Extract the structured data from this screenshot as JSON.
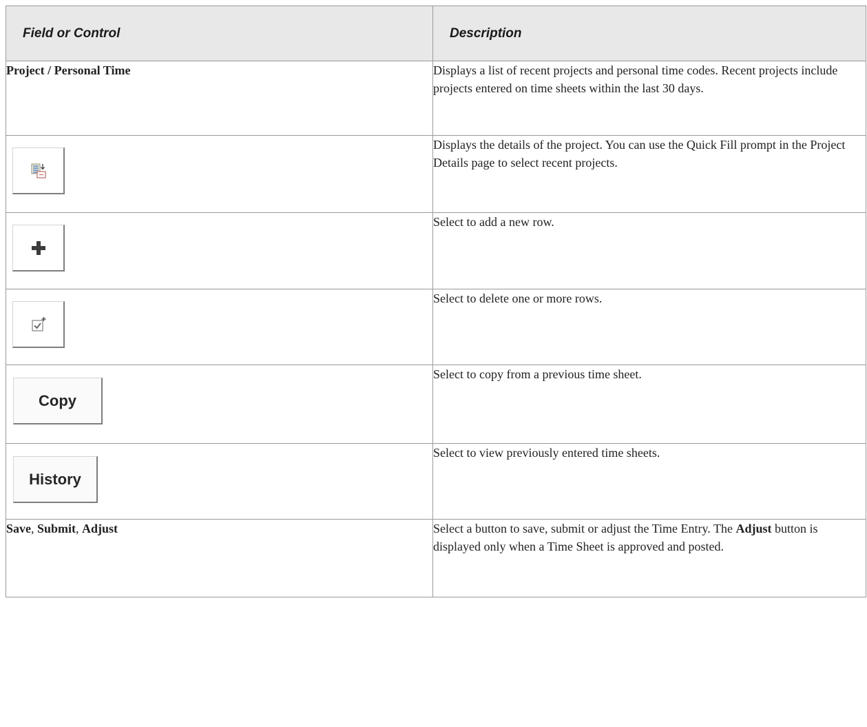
{
  "table": {
    "header": {
      "field": "Field or Control",
      "description": "Description"
    },
    "rows": [
      {
        "field": "Project / Personal Time",
        "description": "Displays a list of recent projects and personal time codes.  Recent projects include projects entered on time sheets within the last 30 days."
      },
      {
        "icon": "project-details-icon",
        "description": "Displays the details of the project. You can use the Quick Fill prompt in the Project Details page to select recent projects."
      },
      {
        "icon": "plus-icon",
        "description": "Select to add a new row."
      },
      {
        "icon": "delete-rows-checkbox-icon",
        "description": "Select to delete one or more rows."
      },
      {
        "button_label": "Copy",
        "description": "Select to copy from a previous time sheet."
      },
      {
        "button_label": "History",
        "description": "Select to view previously entered time sheets."
      },
      {
        "field_parts": [
          "Save",
          ", ",
          "Submit",
          ", ",
          "Adjust"
        ],
        "description_parts": [
          "Select a button to save, submit or adjust the Time Entry.  The ",
          "Adjust",
          " button is displayed only when a Time Sheet is approved and posted."
        ]
      }
    ]
  },
  "colors": {
    "header_bg": "#e8e8e8",
    "border": "#9a9a9a",
    "text": "#222222"
  }
}
